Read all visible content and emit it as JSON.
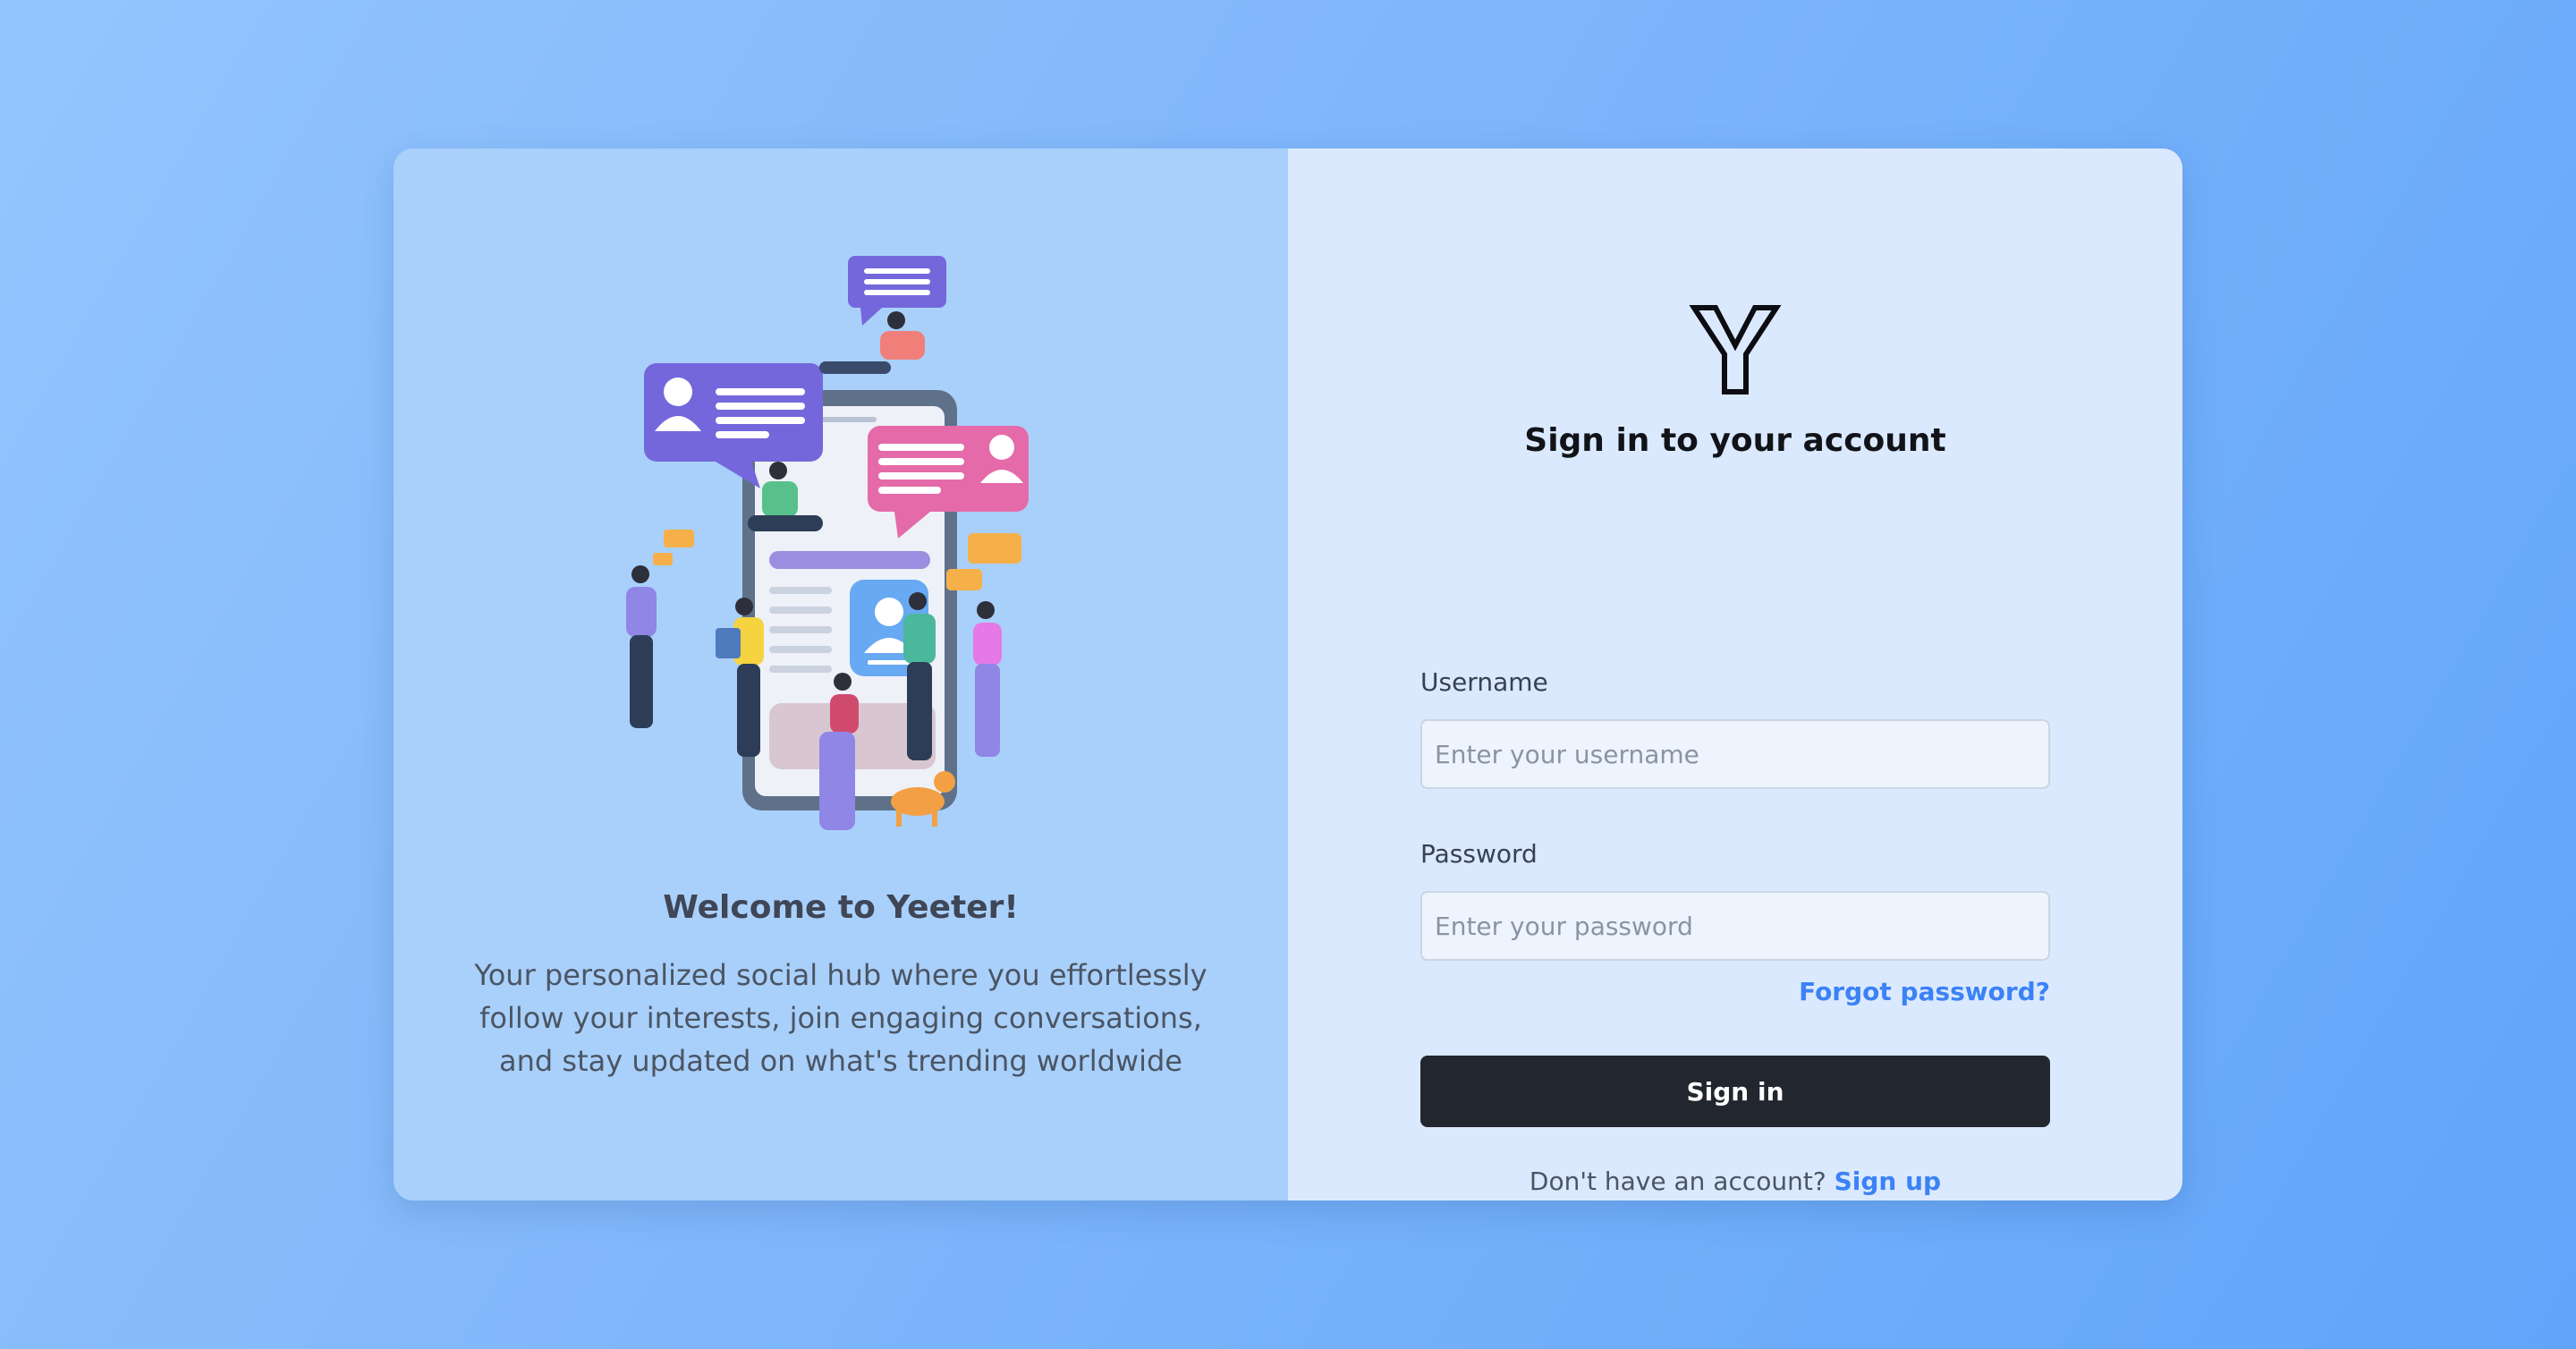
{
  "left_panel": {
    "welcome_title": "Welcome to Yeeter!",
    "welcome_text": "Your personalized social hub where you effortlessly follow your interests, join engaging conversations, and stay updated on what's trending worldwide"
  },
  "right_panel": {
    "logo_icon": "y-logo-icon",
    "title": "Sign in to your account",
    "username": {
      "label": "Username",
      "placeholder": "Enter your username",
      "value": ""
    },
    "password": {
      "label": "Password",
      "placeholder": "Enter your password",
      "value": ""
    },
    "forgot_password": "Forgot password?",
    "signin_button": "Sign in",
    "signup_prompt": "Don't have an account?",
    "signup_link": "Sign up"
  },
  "colors": {
    "background": "#7fb6fb",
    "left_panel": "#a9d0fb",
    "right_panel": "#dbe9fe",
    "button": "#22262e",
    "link": "#3b82f6"
  }
}
